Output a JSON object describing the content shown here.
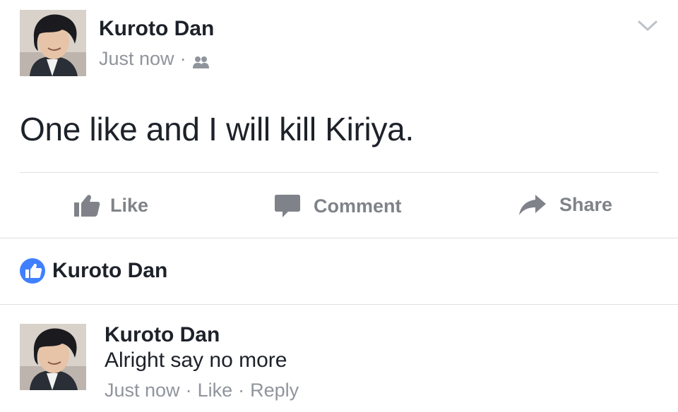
{
  "post": {
    "author": "Kuroto Dan",
    "timestamp": "Just now",
    "separator": "·",
    "audience_icon": "friends-icon",
    "menu_icon": "chevron-down-icon",
    "text": "One like and I will kill Kiriya."
  },
  "actions": {
    "like_label": "Like",
    "comment_label": "Comment",
    "share_label": "Share"
  },
  "likes": {
    "icon": "like-badge-icon",
    "names": "Kuroto Dan",
    "accent": "#4080ff"
  },
  "comment": {
    "author": "Kuroto Dan",
    "text": "Alright say no more",
    "timestamp": "Just now",
    "separator": "·",
    "like_label": "Like",
    "reply_label": "Reply"
  },
  "colors": {
    "text": "#1d2129",
    "muted": "#90949c",
    "action": "#7f8389",
    "divider": "#dddfe2"
  }
}
